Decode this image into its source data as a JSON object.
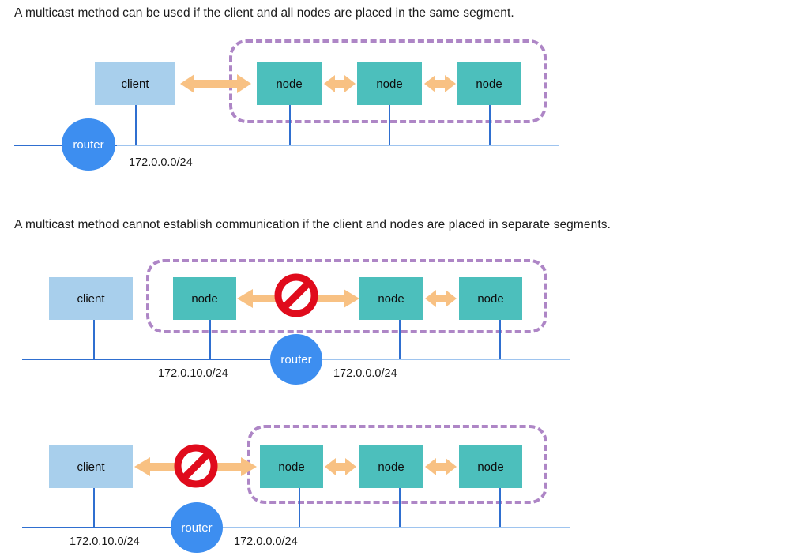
{
  "diagram": {
    "title_line_1": "A multicast method can be used if the client and all nodes are placed in the same segment.",
    "title_line_2": "A multicast method cannot establish communication if the client and nodes are placed in separate segments.",
    "colors": {
      "client_box": "#a8cfec",
      "node_box": "#4cbfbc",
      "arrow": "#f8c183",
      "dashed_segment": "#a071bd",
      "router": "#3d8ef0",
      "network_line": "#2f6fd0",
      "prohibition": "#e00b1c",
      "text": "#1a1a1a"
    },
    "labels": {
      "client": "client",
      "node": "node",
      "router": "router",
      "subnet_a": "172.0.0.0/24",
      "subnet_b": "172.0.10.0/24"
    },
    "sections": [
      {
        "id": "same-segment",
        "caption": "A multicast method can be used if the client and all nodes are placed in the same segment.",
        "client": "client",
        "nodes": [
          "node",
          "node",
          "node"
        ],
        "router": "router",
        "subnets": [
          "172.0.0.0/24"
        ],
        "blocked": false,
        "multicast_group_encloses": [
          "node",
          "node",
          "node"
        ]
      },
      {
        "id": "separate-segments-nodes-split",
        "caption": "A multicast method cannot establish communication if the client and nodes are placed in separate segments.",
        "client": "client",
        "nodes": [
          "node",
          "node",
          "node"
        ],
        "router": "router",
        "subnets": [
          "172.0.10.0/24",
          "172.0.0.0/24"
        ],
        "blocked": true,
        "blocked_between": [
          "node-1",
          "node-2"
        ],
        "multicast_group_encloses": [
          "node",
          "node",
          "node"
        ]
      },
      {
        "id": "separate-segments-client-split",
        "caption": "",
        "client": "client",
        "nodes": [
          "node",
          "node",
          "node"
        ],
        "router": "router",
        "subnets": [
          "172.0.10.0/24",
          "172.0.0.0/24"
        ],
        "blocked": true,
        "blocked_between": [
          "client",
          "node-1"
        ],
        "multicast_group_encloses": [
          "node",
          "node",
          "node"
        ]
      }
    ]
  }
}
